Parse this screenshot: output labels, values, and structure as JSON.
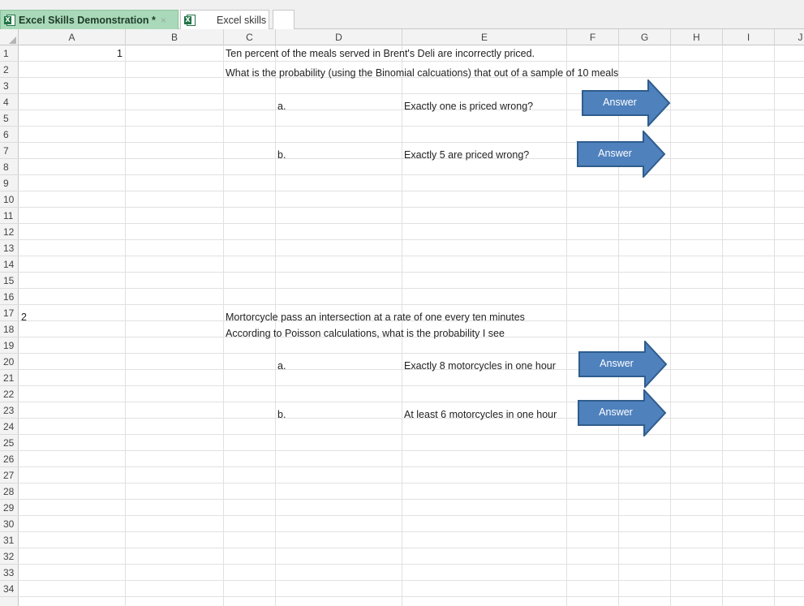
{
  "tabs": {
    "active": {
      "title": "Excel Skills Demonstration *",
      "close": "×"
    },
    "second": {
      "title": "Excel skills"
    }
  },
  "columns": [
    "A",
    "B",
    "C",
    "D",
    "E",
    "F",
    "G",
    "H",
    "I",
    "J"
  ],
  "rows": [
    "1",
    "2",
    "3",
    "4",
    "5",
    "6",
    "7",
    "8",
    "9",
    "10",
    "11",
    "12",
    "13",
    "14",
    "15",
    "16",
    "17",
    "18",
    "19",
    "20",
    "21",
    "22",
    "23",
    "24",
    "25",
    "26",
    "27",
    "28",
    "29",
    "30",
    "31",
    "32",
    "33",
    "34"
  ],
  "cells": {
    "a1": "1",
    "c1": "Ten percent of the meals served in Brent's Deli are incorrectly priced.",
    "c2": "What is the probability (using the Binomial calcuations) that out of a sample of 10 meals",
    "d4": "a.",
    "e4": "Exactly one is priced wrong?",
    "d7": "b.",
    "e7": "Exactly 5 are priced wrong?",
    "a17": "2",
    "c17": "Mortorcycle pass an intersection at a rate of one every ten minutes",
    "c18": "According to Poisson calculations, what is the probability I see",
    "d20": "a.",
    "e20": "Exactly 8 motorcycles in one hour",
    "d23": "b.",
    "e23": "At least 6 motorcycles in one hour"
  },
  "answer_buttons": {
    "q1a": "Answer",
    "q1b": "Answer",
    "q2a": "Answer",
    "q2b": "Answer"
  },
  "colors": {
    "arrow_fill": "#4f81bd",
    "arrow_stroke": "#2f5d8c",
    "active_tab": "#a9d9b8"
  }
}
